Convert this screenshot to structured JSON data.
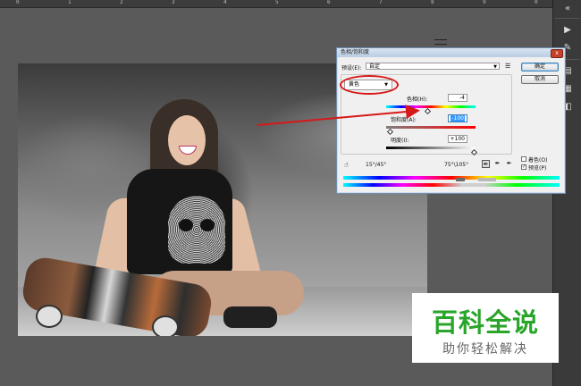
{
  "ruler": {
    "ticks": [
      "0",
      "1",
      "2",
      "3",
      "4",
      "5",
      "6",
      "7",
      "8",
      "9",
      "0"
    ]
  },
  "dialog": {
    "title": "色相/饱和度",
    "close_label": "x",
    "preset_label": "预设(E):",
    "preset_value": "自定",
    "ok_label": "确定",
    "cancel_label": "取消",
    "channel_value": "黄色",
    "hue": {
      "label": "色相(H):",
      "value": "-4"
    },
    "saturation": {
      "label": "饱和度(A):",
      "value": "-100"
    },
    "lightness": {
      "label": "明度(I):",
      "value": "+100"
    },
    "range_left": "15°/45°",
    "range_right": "75°\\105°",
    "colorize_label": "着色(O)",
    "preview_label": "预览(P)",
    "colorize_checked": false,
    "preview_checked": true
  },
  "watermark": {
    "title": "百科全说",
    "subtitle": "助你轻松解决",
    "color": "#2aa52a"
  },
  "colors": {
    "annotation": "#d81818",
    "accent": "#3399ff"
  }
}
